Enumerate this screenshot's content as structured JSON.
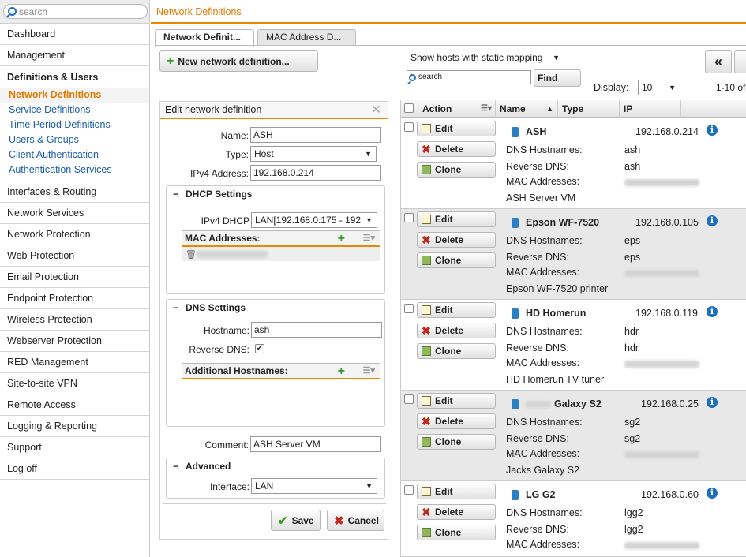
{
  "search": {
    "placeholder": "search"
  },
  "page_title": "Network Definitions",
  "sidebar": {
    "top_items": [
      "Dashboard",
      "Management"
    ],
    "group": {
      "label": "Definitions & Users",
      "items": [
        {
          "label": "Network Definitions",
          "active": true
        },
        {
          "label": "Service Definitions"
        },
        {
          "label": "Time Period Definitions"
        },
        {
          "label": "Users & Groups"
        },
        {
          "label": "Client Authentication"
        },
        {
          "label": "Authentication Services"
        }
      ]
    },
    "items": [
      "Interfaces & Routing",
      "Network Services",
      "Network Protection",
      "Web Protection",
      "Email Protection",
      "Endpoint Protection",
      "Wireless Protection",
      "Webserver Protection",
      "RED Management",
      "Site-to-site VPN",
      "Remote Access",
      "Logging & Reporting",
      "Support",
      "Log off"
    ]
  },
  "tabs": [
    "Network Definit...",
    "MAC Address D..."
  ],
  "toolbar": {
    "new_button": "New network definition...",
    "filter_select": "Show hosts with static mapping",
    "search_placeholder": "search",
    "find_button": "Find",
    "display_label": "Display:",
    "display_value": "10",
    "range_text": "1-10 of",
    "prev_label": "«"
  },
  "edit": {
    "title": "Edit network definition",
    "name_label": "Name:",
    "name_value": "ASH",
    "type_label": "Type:",
    "type_value": "Host",
    "ipv4_label": "IPv4 Address:",
    "ipv4_value": "192.168.0.214",
    "dhcp": {
      "title": "DHCP Settings",
      "ipv4_dhcp_label": "IPv4 DHCP",
      "ipv4_dhcp_value": "LAN[192.168.0.175 - 192",
      "mac_title": "MAC Addresses:"
    },
    "dns": {
      "title": "DNS Settings",
      "hostname_label": "Hostname:",
      "hostname_value": "ash",
      "reverse_label": "Reverse DNS:",
      "reverse_checked": true,
      "additional_title": "Additional Hostnames:"
    },
    "comment_label": "Comment:",
    "comment_value": "ASH Server VM",
    "advanced": {
      "title": "Advanced",
      "interface_label": "Interface:",
      "interface_value": "LAN"
    },
    "save": "Save",
    "cancel": "Cancel"
  },
  "list": {
    "columns": [
      "Action",
      "Name",
      "Type",
      "IP"
    ],
    "action_labels": {
      "edit": "Edit",
      "delete": "Delete",
      "clone": "Clone"
    },
    "detail_labels": {
      "dns": "DNS Hostnames:",
      "reverse": "Reverse DNS:",
      "mac": "MAC Addresses:"
    },
    "rows": [
      {
        "name": "ASH",
        "ip": "192.168.0.214",
        "dns": "ash",
        "reverse": "ash",
        "comment": "ASH Server VM"
      },
      {
        "name": "Epson WF-7520",
        "ip": "192.168.0.105",
        "dns": "eps",
        "reverse": "eps",
        "comment": "Epson WF-7520 printer"
      },
      {
        "name": "HD Homerun",
        "ip": "192.168.0.119",
        "dns": "hdr",
        "reverse": "hdr",
        "comment": "HD Homerun TV tuner"
      },
      {
        "name": "Galaxy S2",
        "ip": "192.168.0.25",
        "dns": "sg2",
        "reverse": "sg2",
        "comment": "Jacks Galaxy S2"
      },
      {
        "name": "LG G2",
        "ip": "192.168.0.60",
        "dns": "lgg2",
        "reverse": "lgg2",
        "comment": ""
      }
    ]
  }
}
